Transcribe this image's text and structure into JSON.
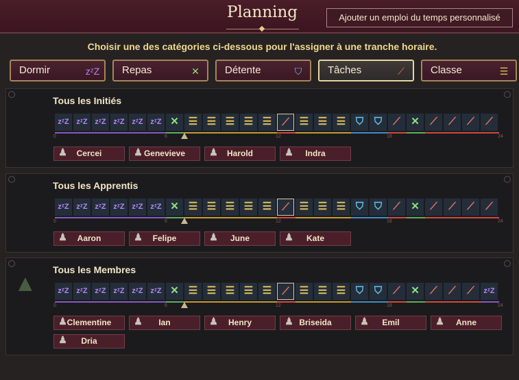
{
  "header": {
    "title": "Planning",
    "custom_button": "Ajouter un emploi du temps personnalisé"
  },
  "instruction": "Choisir une des catégories ci-dessous pour l'assigner à une tranche horaire.",
  "categories": [
    {
      "label": "Dormir",
      "icon": "sleep-icon",
      "glyph": "zᶻZ",
      "color": "#b287f0",
      "selected": false
    },
    {
      "label": "Repas",
      "icon": "utensils-icon",
      "glyph": "✕",
      "color": "#8ee07d",
      "selected": false
    },
    {
      "label": "Détente",
      "icon": "ghost-icon",
      "glyph": "⛉",
      "color": "#64c4ee",
      "selected": false
    },
    {
      "label": "Tâches",
      "icon": "broom-icon",
      "glyph": "⟋",
      "color": "#f07060",
      "selected": true
    },
    {
      "label": "Classe",
      "icon": "books-icon",
      "glyph": "☰",
      "color": "#e2c15a",
      "selected": false
    }
  ],
  "tick_labels": [
    "0",
    "6",
    "12",
    "18",
    "24"
  ],
  "current_hour": 7,
  "groups": [
    {
      "title": "Tous les Initiés",
      "schedule": [
        "sleep",
        "sleep",
        "sleep",
        "sleep",
        "sleep",
        "sleep",
        "meal",
        "class",
        "class",
        "class",
        "class",
        "class",
        "chore",
        "class",
        "class",
        "class",
        "leisure",
        "leisure",
        "chore",
        "meal",
        "chore",
        "chore",
        "chore",
        "chore"
      ],
      "members": [
        "Cercei",
        "Genevieve",
        "Harold",
        "Indra"
      ]
    },
    {
      "title": "Tous les Apprentis",
      "schedule": [
        "sleep",
        "sleep",
        "sleep",
        "sleep",
        "sleep",
        "sleep",
        "meal",
        "class",
        "class",
        "class",
        "class",
        "class",
        "chore",
        "class",
        "class",
        "class",
        "leisure",
        "leisure",
        "chore",
        "meal",
        "chore",
        "chore",
        "chore",
        "chore"
      ],
      "members": [
        "Aaron",
        "Felipe",
        "June",
        "Kate"
      ]
    },
    {
      "title": "Tous les Membres",
      "schedule": [
        "sleep",
        "sleep",
        "sleep",
        "sleep",
        "sleep",
        "sleep",
        "meal",
        "class",
        "class",
        "class",
        "class",
        "class",
        "chore",
        "class",
        "class",
        "class",
        "leisure",
        "leisure",
        "chore",
        "meal",
        "chore",
        "chore",
        "chore",
        "sleep"
      ],
      "members": [
        "Clementine",
        "Ian",
        "Henry",
        "Briseida",
        "Emil",
        "Anne",
        "Dria"
      ],
      "icon": "witch-hat-icon"
    }
  ],
  "slot_glyphs": {
    "sleep": "zᶻZ",
    "meal": "✕",
    "leisure": "⛉",
    "chore": "⟋",
    "class": "☰"
  },
  "segment_colors": {
    "sleep": "#8758c8",
    "meal": "#5fae62",
    "class": "#c79a32",
    "chore": "#d24a40",
    "leisure": "#3f8ec8"
  }
}
